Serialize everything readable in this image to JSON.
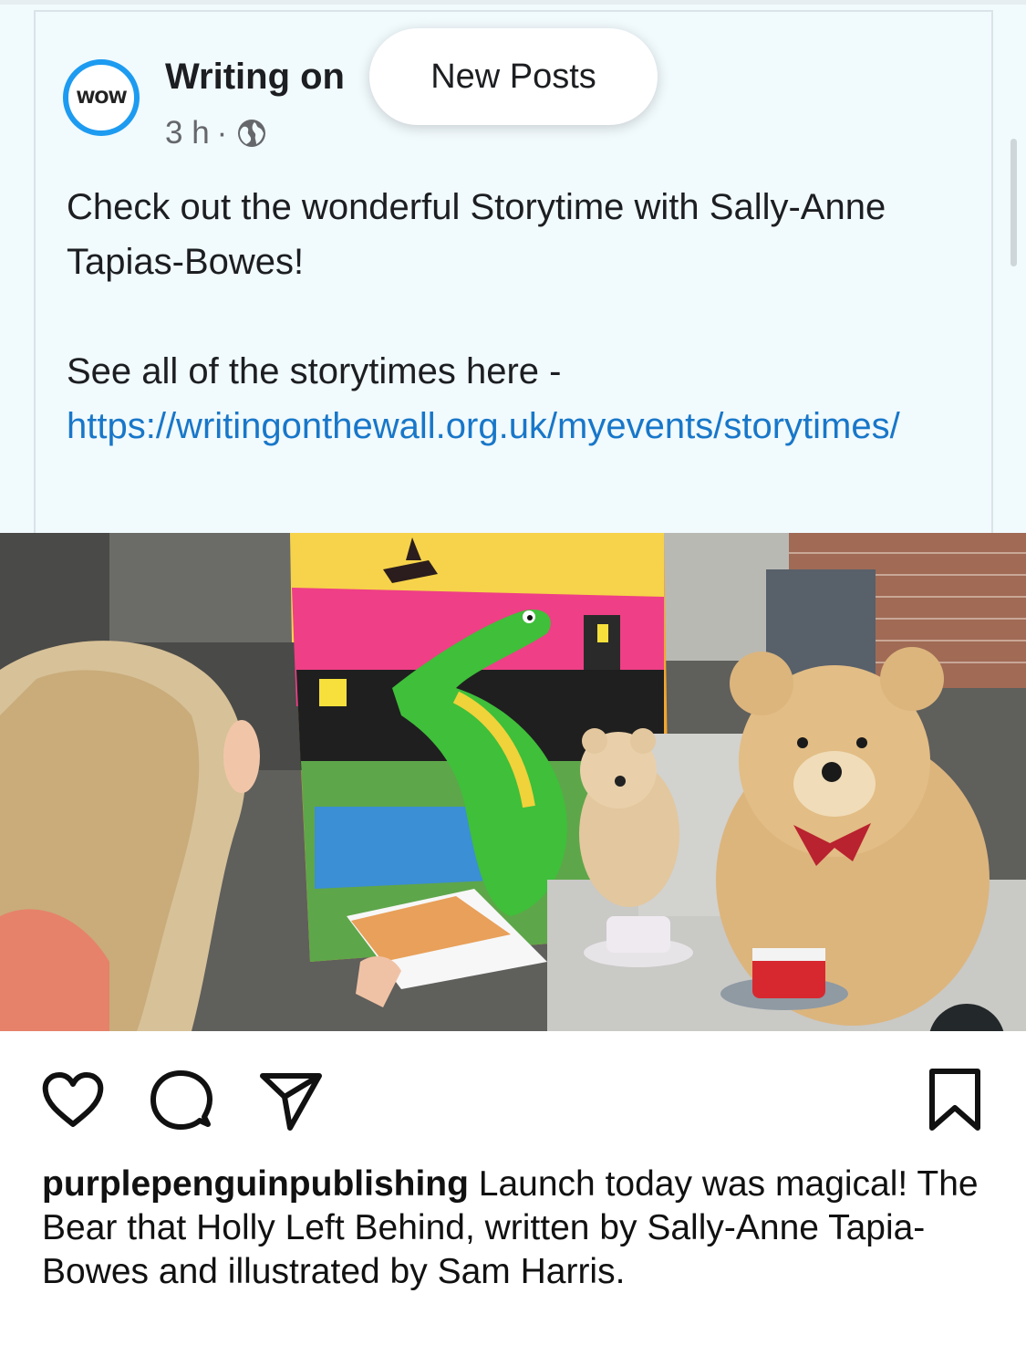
{
  "post": {
    "page_name": "Writing on",
    "avatar_logo": "WOW",
    "time": "3 h",
    "separator": "·",
    "visibility_icon": "globe-icon",
    "text_line1": "Check out the wonderful Storytime with Sally-Anne Tapias-Bowes!",
    "text_line2": "See all of the storytimes here -",
    "link": "https://writingonthewall.org.uk/myevents/storytimes/"
  },
  "banner": {
    "new_posts_label": "New Posts"
  },
  "photo": {
    "description_icon": "storytime-photo"
  },
  "actions": {
    "like_icon": "heart-icon",
    "comment_icon": "comment-icon",
    "share_icon": "send-icon",
    "save_icon": "bookmark-icon"
  },
  "caption": {
    "username": "purplepenguinpublishing",
    "text": "Launch today was magical! The Bear that Holly Left Behind, written by Sally-Anne Tapia-Bowes and illustrated by Sam Harris."
  },
  "colors": {
    "link": "#1877c9",
    "avatar_ring": "#1d9bf0",
    "card_bg": "#f1fafd"
  }
}
